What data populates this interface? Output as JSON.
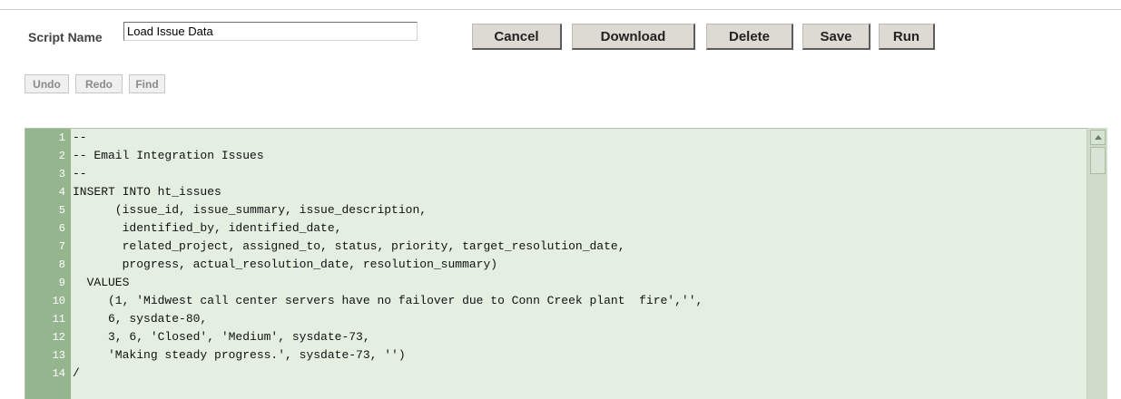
{
  "form": {
    "script_name_label": "Script Name",
    "script_name_value": "Load Issue Data"
  },
  "buttons": {
    "cancel": "Cancel",
    "download": "Download",
    "delete": "Delete",
    "save": "Save",
    "run": "Run"
  },
  "toolbar": {
    "undo": "Undo",
    "redo": "Redo",
    "find": "Find"
  },
  "editor": {
    "lines": [
      {
        "n": "1",
        "text": "--"
      },
      {
        "n": "2",
        "text": "-- Email Integration Issues"
      },
      {
        "n": "3",
        "text": "--"
      },
      {
        "n": "4",
        "text": "INSERT INTO ht_issues"
      },
      {
        "n": "5",
        "text": "      (issue_id, issue_summary, issue_description,"
      },
      {
        "n": "6",
        "text": "       identified_by, identified_date,"
      },
      {
        "n": "7",
        "text": "       related_project, assigned_to, status, priority, target_resolution_date,"
      },
      {
        "n": "8",
        "text": "       progress, actual_resolution_date, resolution_summary)"
      },
      {
        "n": "9",
        "text": "  VALUES"
      },
      {
        "n": "10",
        "text": "     (1, 'Midwest call center servers have no failover due to Conn Creek plant  fire','',"
      },
      {
        "n": "11",
        "text": "     6, sysdate-80,"
      },
      {
        "n": "12",
        "text": "     3, 6, 'Closed', 'Medium', sysdate-73,"
      },
      {
        "n": "13",
        "text": "     'Making steady progress.', sysdate-73, '')"
      },
      {
        "n": "14",
        "text": "/"
      }
    ]
  },
  "colors": {
    "gutter": "#95b58e",
    "editor_bg": "#e4eee1",
    "button_bg": "#dcdad2"
  },
  "icons": {
    "scroll_up": "scroll-up-arrow-icon"
  }
}
